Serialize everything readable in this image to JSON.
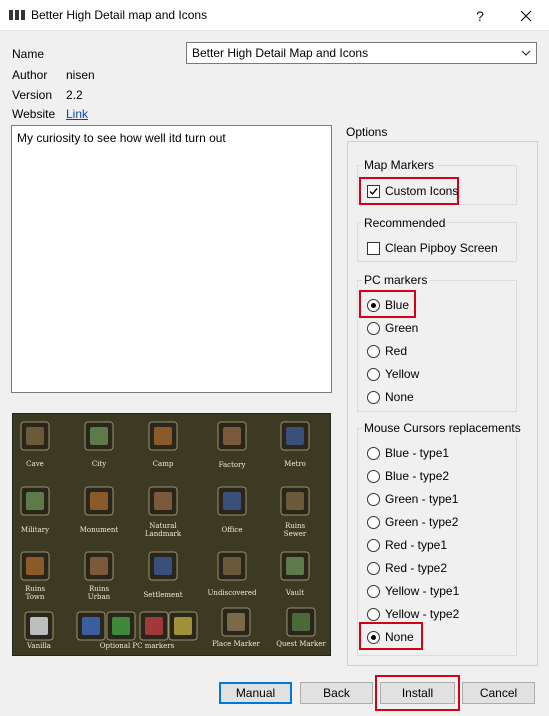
{
  "window": {
    "title": "Better High Detail map and Icons",
    "help_glyph": "?",
    "close_glyph": "✕"
  },
  "info": {
    "name_label": "Name",
    "name_value": "Better High Detail Map and Icons",
    "author_label": "Author",
    "author_value": "nisen",
    "version_label": "Version",
    "version_value": "2.2",
    "website_label": "Website",
    "website_link": "Link"
  },
  "description": "My curiosity to see how well itd turn out",
  "preview_image": {
    "labels": [
      "Cave",
      "City",
      "Camp",
      "Factory",
      "Metro",
      "Military",
      "Monument",
      "Natural Landmark",
      "Office",
      "Ruins Sewer",
      "Ruins Town",
      "Ruins Urban",
      "Settlement",
      "Undiscovered",
      "Vault",
      "Vanilla",
      "Optional PC markers",
      "Place Marker",
      "Quest Marker"
    ]
  },
  "options": {
    "title": "Options",
    "groups": [
      {
        "title": "Map Markers",
        "items": [
          {
            "label": "Custom Icons",
            "type": "checkbox",
            "checked": true
          }
        ]
      },
      {
        "title": "Recommended",
        "items": [
          {
            "label": "Clean Pipboy Screen",
            "type": "checkbox",
            "checked": false
          }
        ]
      },
      {
        "title": "PC markers",
        "items": [
          {
            "label": "Blue",
            "type": "radio",
            "checked": true
          },
          {
            "label": "Green",
            "type": "radio",
            "checked": false
          },
          {
            "label": "Red",
            "type": "radio",
            "checked": false
          },
          {
            "label": "Yellow",
            "type": "radio",
            "checked": false
          },
          {
            "label": "None",
            "type": "radio",
            "checked": false
          }
        ]
      },
      {
        "title": "Mouse Cursors replacements",
        "items": [
          {
            "label": "Blue - type1",
            "type": "radio",
            "checked": false
          },
          {
            "label": "Blue - type2",
            "type": "radio",
            "checked": false
          },
          {
            "label": "Green - type1",
            "type": "radio",
            "checked": false
          },
          {
            "label": "Green - type2",
            "type": "radio",
            "checked": false
          },
          {
            "label": "Red - type1",
            "type": "radio",
            "checked": false
          },
          {
            "label": "Red - type2",
            "type": "radio",
            "checked": false
          },
          {
            "label": "Yellow - type1",
            "type": "radio",
            "checked": false
          },
          {
            "label": "Yellow - type2",
            "type": "radio",
            "checked": false
          },
          {
            "label": "None",
            "type": "radio",
            "checked": true
          }
        ]
      }
    ]
  },
  "buttons": {
    "manual": "Manual",
    "back": "Back",
    "install": "Install",
    "cancel": "Cancel"
  },
  "colors": {
    "highlight": "#d0021b",
    "link": "#0645ad",
    "default_button_border": "#0078d7",
    "preview_background": "#3d3a24"
  }
}
